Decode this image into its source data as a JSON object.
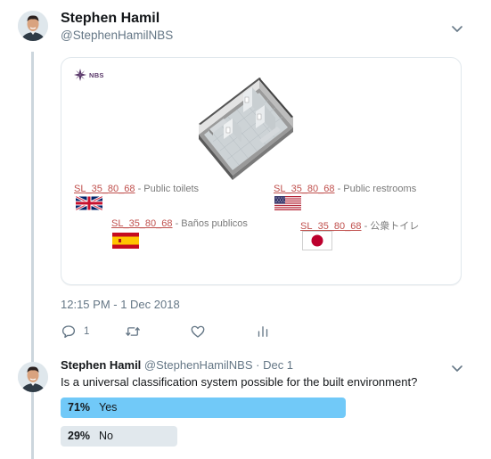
{
  "tweet": {
    "author_name": "Stephen Hamil",
    "author_handle": "@StephenHamilNBS",
    "card": {
      "logo_text": "NBS",
      "labels": [
        {
          "code": "SL_35_80_68",
          "text": " - Public toilets",
          "flag": "uk-flag-icon"
        },
        {
          "code": "SL_35_80_68",
          "text": " - Public restrooms",
          "flag": "us-flag-icon"
        },
        {
          "code": "SL_35_80_68",
          "text": " - Baños publicos",
          "flag": "spain-flag-icon"
        },
        {
          "code": "SL_35_80_68",
          "text": " - 公衆トイレ",
          "flag": "japan-flag-icon"
        }
      ]
    },
    "timestamp": "12:15 PM - 1 Dec 2018",
    "actions": {
      "reply_count": "1",
      "retweet_count": "",
      "like_count": ""
    }
  },
  "quoted": {
    "author_name": "Stephen Hamil",
    "author_handle": "@StephenHamilNBS",
    "separator": " · ",
    "date": "Dec 1",
    "text": "Is a universal classification system possible for the built environment?",
    "poll": [
      {
        "percent": "71%",
        "label": "Yes",
        "fraction": 0.71,
        "color": "#71c9f8",
        "leading": true
      },
      {
        "percent": "29%",
        "label": "No",
        "fraction": 0.29,
        "color": "#e1e8ed",
        "leading": false
      }
    ]
  },
  "colors": {
    "accent": "#1da1f2",
    "muted": "#657786",
    "code_link": "#c0504d",
    "thread_line": "#ccd6dd"
  }
}
